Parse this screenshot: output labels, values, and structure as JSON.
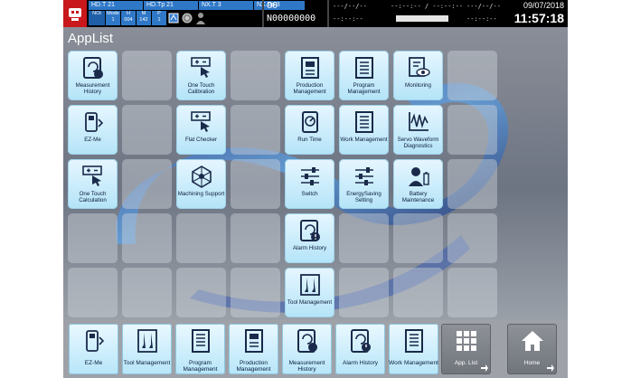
{
  "status": {
    "row1": [
      "HD.T 21",
      "HD.Tp 21",
      "NX.T 3",
      "NX.Tp 3"
    ],
    "mode": [
      {
        "top": "NOt",
        "bottom": ""
      },
      {
        "top": "Mode",
        "bottom": "1"
      },
      {
        "top": "H",
        "bottom": "004"
      },
      {
        "top": "M",
        "bottom": "142"
      },
      {
        "top": "P",
        "bottom": "1"
      }
    ],
    "program": {
      "o_number": "O0",
      "n_number": "N00000000"
    },
    "timers": {
      "left_top": "---/--/--",
      "left_bottom": "--:--:--",
      "mid_top": "--:--:-- / --:--:--",
      "right_top": "---/--/--",
      "right_bottom": "--:--:--"
    },
    "date": "09/07/2018",
    "time": "11:57:18"
  },
  "page_title": "AppList",
  "apps": [
    {
      "label": "Measurement History",
      "icon": "measurement-history-icon"
    },
    {
      "label": "One Touch Calibration",
      "icon": "one-touch-calibration-icon"
    },
    {
      "label": "Production Management",
      "icon": "production-management-icon"
    },
    {
      "label": "Program Management",
      "icon": "program-management-icon"
    },
    {
      "label": "Monitoring",
      "icon": "monitoring-icon"
    },
    {
      "label": "EZ-Me",
      "icon": "ez-me-icon"
    },
    {
      "label": "Flat Checker",
      "icon": "flat-checker-icon"
    },
    {
      "label": "Run Time",
      "icon": "run-time-icon"
    },
    {
      "label": "Work Management",
      "icon": "work-management-icon"
    },
    {
      "label": "Servo Waveform Diagnostics",
      "icon": "servo-waveform-icon"
    },
    {
      "label": "One Touch Calculation",
      "icon": "one-touch-calculation-icon"
    },
    {
      "label": "Machining Support",
      "icon": "machining-support-icon"
    },
    {
      "label": "Switch",
      "icon": "switch-icon"
    },
    {
      "label": "EnergySaving Setting",
      "icon": "energy-saving-icon"
    },
    {
      "label": "Battery Maintenance",
      "icon": "battery-maintenance-icon"
    },
    {
      "label": "Alarm History",
      "icon": "alarm-history-icon"
    },
    {
      "label": "Tool Management",
      "icon": "tool-management-icon"
    }
  ],
  "dock": [
    {
      "label": "EZ-Me",
      "icon": "ez-me-icon"
    },
    {
      "label": "Tool Management",
      "icon": "tool-management-icon"
    },
    {
      "label": "Program Management",
      "icon": "program-management-icon"
    },
    {
      "label": "Production Management",
      "icon": "production-management-icon"
    },
    {
      "label": "Measurement History",
      "icon": "measurement-history-icon"
    },
    {
      "label": "Alarm History",
      "icon": "alarm-history-icon"
    },
    {
      "label": "Work Management",
      "icon": "work-management-icon"
    },
    {
      "label": "App. List",
      "icon": "app-list-icon"
    },
    {
      "label": "Home",
      "icon": "home-icon"
    }
  ],
  "colors": {
    "accent": "#2f78c8",
    "tile": "#b4e4f8",
    "logo": "#c8181c"
  }
}
